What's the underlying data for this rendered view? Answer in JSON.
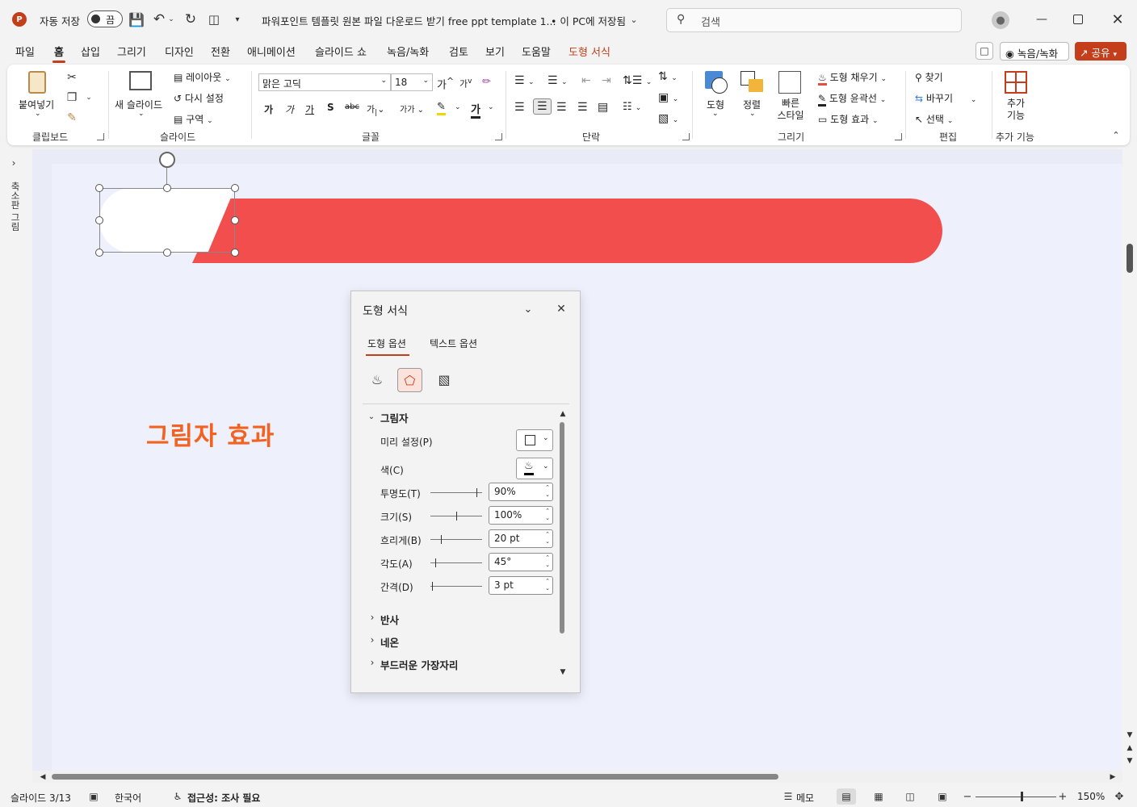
{
  "titlebar": {
    "autosave_label": "자동 저장",
    "autosave_state": "끔",
    "doc_title": "파워포인트 템플릿 원본 파일 다운로드 받기 free ppt template 1...",
    "save_location": "• 이 PC에 저장됨",
    "search_placeholder": "검색"
  },
  "menu": {
    "tabs": [
      "파일",
      "홈",
      "삽입",
      "그리기",
      "디자인",
      "전환",
      "애니메이션",
      "슬라이드 쇼",
      "녹음/녹화",
      "검토",
      "보기",
      "도움말",
      "도형 서식"
    ],
    "active_tab": "홈",
    "contextual_tab": "도형 서식",
    "record_button": "녹음/녹화",
    "share_button": "공유"
  },
  "ribbon": {
    "clipboard": {
      "paste": "붙여넣기",
      "label": "클립보드"
    },
    "slides": {
      "new_slide": "새 슬라이드",
      "layout": "레이아웃",
      "reset": "다시 설정",
      "section": "구역",
      "label": "슬라이드"
    },
    "font": {
      "name": "맑은 고딕",
      "size": "18",
      "label": "글꼴"
    },
    "paragraph": {
      "label": "단락"
    },
    "drawing": {
      "shapes": "도형",
      "arrange": "정렬",
      "quick_styles": "빠른\n스타일",
      "fill": "도형 채우기",
      "outline": "도형 윤곽선",
      "effects": "도형 효과",
      "label": "그리기"
    },
    "editing": {
      "find": "찾기",
      "replace": "바꾸기",
      "select": "선택",
      "label": "편집"
    },
    "addins": {
      "button": "추가\n기능",
      "label": "추가 기능"
    }
  },
  "left_panel": {
    "label": "축소판 그림"
  },
  "slide": {
    "heading": "그림자 효과",
    "heading_color": "#f26322",
    "bar_color": "#f24e4e"
  },
  "format_pane": {
    "title": "도형 서식",
    "tabs": [
      "도형 옵션",
      "텍스트 옵션"
    ],
    "section_shadow": "그림자",
    "rows": [
      {
        "label": "미리 설정(P)"
      },
      {
        "label": "색(C)"
      }
    ],
    "sliders": [
      {
        "label": "투명도(T)",
        "value": "90%",
        "level": 0.9
      },
      {
        "label": "크기(S)",
        "value": "100%",
        "level": 0.5
      },
      {
        "label": "흐리게(B)",
        "value": "20 pt",
        "level": 0.2
      },
      {
        "label": "각도(A)",
        "value": "45°",
        "level": 0.1
      },
      {
        "label": "간격(D)",
        "value": "3 pt",
        "level": 0.03
      }
    ],
    "collapsed_sections": [
      "반사",
      "네온",
      "부드러운 가장자리"
    ]
  },
  "statusbar": {
    "slide_info": "슬라이드 3/13",
    "language": "한국어",
    "accessibility": "접근성: 조사 필요",
    "notes": "메모",
    "zoom": "150%"
  },
  "colors": {
    "accent": "#c43e1c",
    "share": "#c43e1c"
  }
}
